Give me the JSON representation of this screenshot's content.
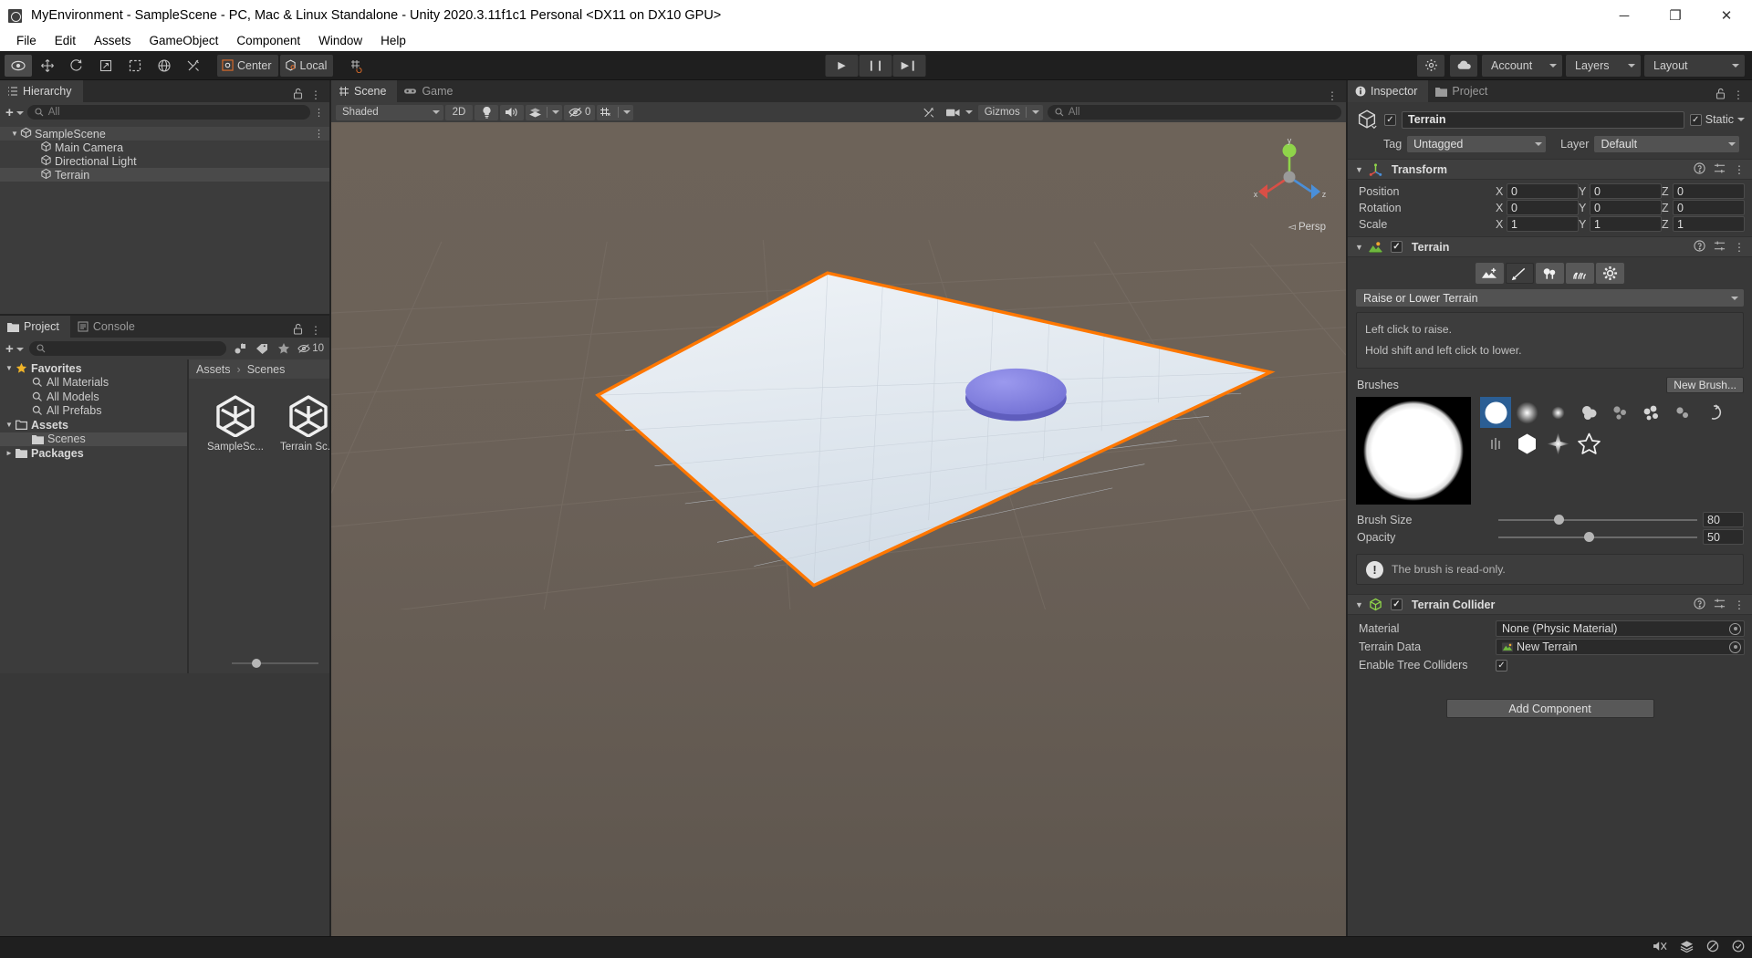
{
  "window": {
    "title": "MyEnvironment - SampleScene - PC, Mac & Linux Standalone - Unity 2020.3.11f1c1 Personal <DX11 on DX10 GPU>",
    "minimize": "─",
    "maximize": "❐",
    "close": "✕"
  },
  "menubar": {
    "items": [
      "File",
      "Edit",
      "Assets",
      "GameObject",
      "Component",
      "Window",
      "Help"
    ]
  },
  "toolbar": {
    "tools": [
      {
        "name": "hand-tool",
        "icon": "◉"
      },
      {
        "name": "move-tool",
        "icon": "✥"
      },
      {
        "name": "rotate-tool",
        "icon": "↻"
      },
      {
        "name": "scale-tool",
        "icon": "↗"
      },
      {
        "name": "rect-tool",
        "icon": "⬚"
      },
      {
        "name": "transform-tool",
        "icon": "⎈"
      },
      {
        "name": "custom-editor-tool",
        "icon": "⚒"
      }
    ],
    "pivot_mode": "Center",
    "pivot_rotation": "Local",
    "grid_snap_icon": "grid-snapping-icon",
    "play": "▶",
    "pause": "❙❙",
    "step": "▶❙",
    "cloud_icon": "cloud-icon",
    "collab_icon": "services-icon",
    "account": "Account",
    "layers": "Layers",
    "layout": "Layout"
  },
  "hierarchy": {
    "tab": "Hierarchy",
    "tab_icon": "hierarchy-icon",
    "search_placeholder": "All",
    "create_label": "+",
    "items": [
      {
        "label": "SampleScene",
        "depth": 0,
        "type": "scene",
        "expanded": true
      },
      {
        "label": "Main Camera",
        "depth": 1,
        "type": "gameobject"
      },
      {
        "label": "Directional Light",
        "depth": 1,
        "type": "gameobject"
      },
      {
        "label": "Terrain",
        "depth": 1,
        "type": "gameobject",
        "selected": true
      }
    ]
  },
  "scene": {
    "tabs": [
      {
        "label": "Scene",
        "icon": "scene-grid-icon",
        "active": true
      },
      {
        "label": "Game",
        "icon": "gamepad-icon",
        "active": false
      }
    ],
    "draw_mode": "Shaded",
    "two_d": "2D",
    "lighting_icon": "lightbulb-icon",
    "audio_icon": "speaker-icon",
    "fx_icon": "effects-icon",
    "hidden_count": "0",
    "grid_icon": "grid-visibility-icon",
    "tools_icon": "scene-tools-icon",
    "camera_icon": "scene-camera-icon",
    "gizmos": "Gizmos",
    "search_placeholder": "All",
    "persp_label": "Persp",
    "gizmo_axes": {
      "x": "x",
      "y": "y",
      "z": "z"
    }
  },
  "project": {
    "tabs": [
      {
        "label": "Project",
        "icon": "folder-icon",
        "active": true
      },
      {
        "label": "Console",
        "icon": "console-icon",
        "active": false
      }
    ],
    "create_label": "+",
    "search_placeholder": "",
    "tree": [
      {
        "label": "Favorites",
        "depth": 0,
        "icon": "star-icon",
        "expanded": true,
        "bold": true
      },
      {
        "label": "All Materials",
        "depth": 1,
        "icon": "search-icon"
      },
      {
        "label": "All Models",
        "depth": 1,
        "icon": "search-icon"
      },
      {
        "label": "All Prefabs",
        "depth": 1,
        "icon": "search-icon"
      },
      {
        "label": "Assets",
        "depth": 0,
        "icon": "folder-open-icon",
        "expanded": true,
        "bold": true
      },
      {
        "label": "Scenes",
        "depth": 1,
        "icon": "folder-icon",
        "selected": true
      },
      {
        "label": "Packages",
        "depth": 0,
        "icon": "folder-icon",
        "expanded": false,
        "bold": true
      }
    ],
    "breadcrumb": [
      "Assets",
      "Scenes"
    ],
    "assets": [
      {
        "label": "SampleSc...",
        "icon": "unity-scene-icon"
      },
      {
        "label": "Terrain Sc...",
        "icon": "unity-scene-icon"
      }
    ],
    "filter_icons": [
      "asset-type-filter-icon",
      "label-filter-icon",
      "favorite-filter-icon"
    ],
    "hidden_items_count": "10"
  },
  "inspector": {
    "tabs": [
      {
        "label": "Inspector",
        "icon": "info-icon",
        "active": true
      },
      {
        "label": "Project",
        "icon": "folder-icon",
        "active": false
      }
    ],
    "gameobject": {
      "enabled": true,
      "name": "Terrain",
      "static_label": "Static",
      "static_checked": true,
      "tag_label": "Tag",
      "tag_value": "Untagged",
      "layer_label": "Layer",
      "layer_value": "Default"
    },
    "transform": {
      "title": "Transform",
      "rows": [
        {
          "label": "Position",
          "x": "0",
          "y": "0",
          "z": "0"
        },
        {
          "label": "Rotation",
          "x": "0",
          "y": "0",
          "z": "0"
        },
        {
          "label": "Scale",
          "x": "1",
          "y": "1",
          "z": "1"
        }
      ]
    },
    "terrain": {
      "title": "Terrain",
      "enabled": true,
      "tool_tabs": [
        {
          "name": "create-neighbor-terrains-tool",
          "icon": "terrain-add-icon",
          "active": false
        },
        {
          "name": "paint-terrain-tool",
          "icon": "brush-icon",
          "active": true
        },
        {
          "name": "paint-trees-tool",
          "icon": "trees-icon",
          "active": false
        },
        {
          "name": "paint-details-tool",
          "icon": "grass-icon",
          "active": false
        },
        {
          "name": "terrain-settings-tool",
          "icon": "gear-icon",
          "active": false
        }
      ],
      "mode": "Raise or Lower Terrain",
      "help_lines": [
        "Left click to raise.",
        "Hold shift and left click to lower."
      ],
      "brushes_label": "Brushes",
      "new_brush_label": "New Brush...",
      "brush_count": 13,
      "selected_brush_index": 0,
      "brush_size_label": "Brush Size",
      "brush_size_value": "80",
      "brush_size_pct": 28,
      "opacity_label": "Opacity",
      "opacity_value": "50",
      "opacity_pct": 43,
      "readonly_warning": "The brush is read-only."
    },
    "terrain_collider": {
      "title": "Terrain Collider",
      "enabled": true,
      "material_label": "Material",
      "material_value": "None (Physic Material)",
      "terrain_data_label": "Terrain Data",
      "terrain_data_value": "New Terrain",
      "tree_colliders_label": "Enable Tree Colliders",
      "tree_colliders_checked": true
    },
    "add_component_label": "Add Component"
  },
  "statusbar": {
    "icons": [
      "mute-audio-icon",
      "layers-status-icon",
      "no-preview-icon",
      "check-circle-icon"
    ]
  },
  "colors": {
    "accent_orange": "#ff7700",
    "selection_blue": "#2b5e94",
    "terrain_surface": "#dfe7ee",
    "disc_purple": "#7f7de0",
    "panel_bg": "#383838",
    "panel_light": "#3c3c3c",
    "toolbar_bg": "#1f1f1f"
  }
}
